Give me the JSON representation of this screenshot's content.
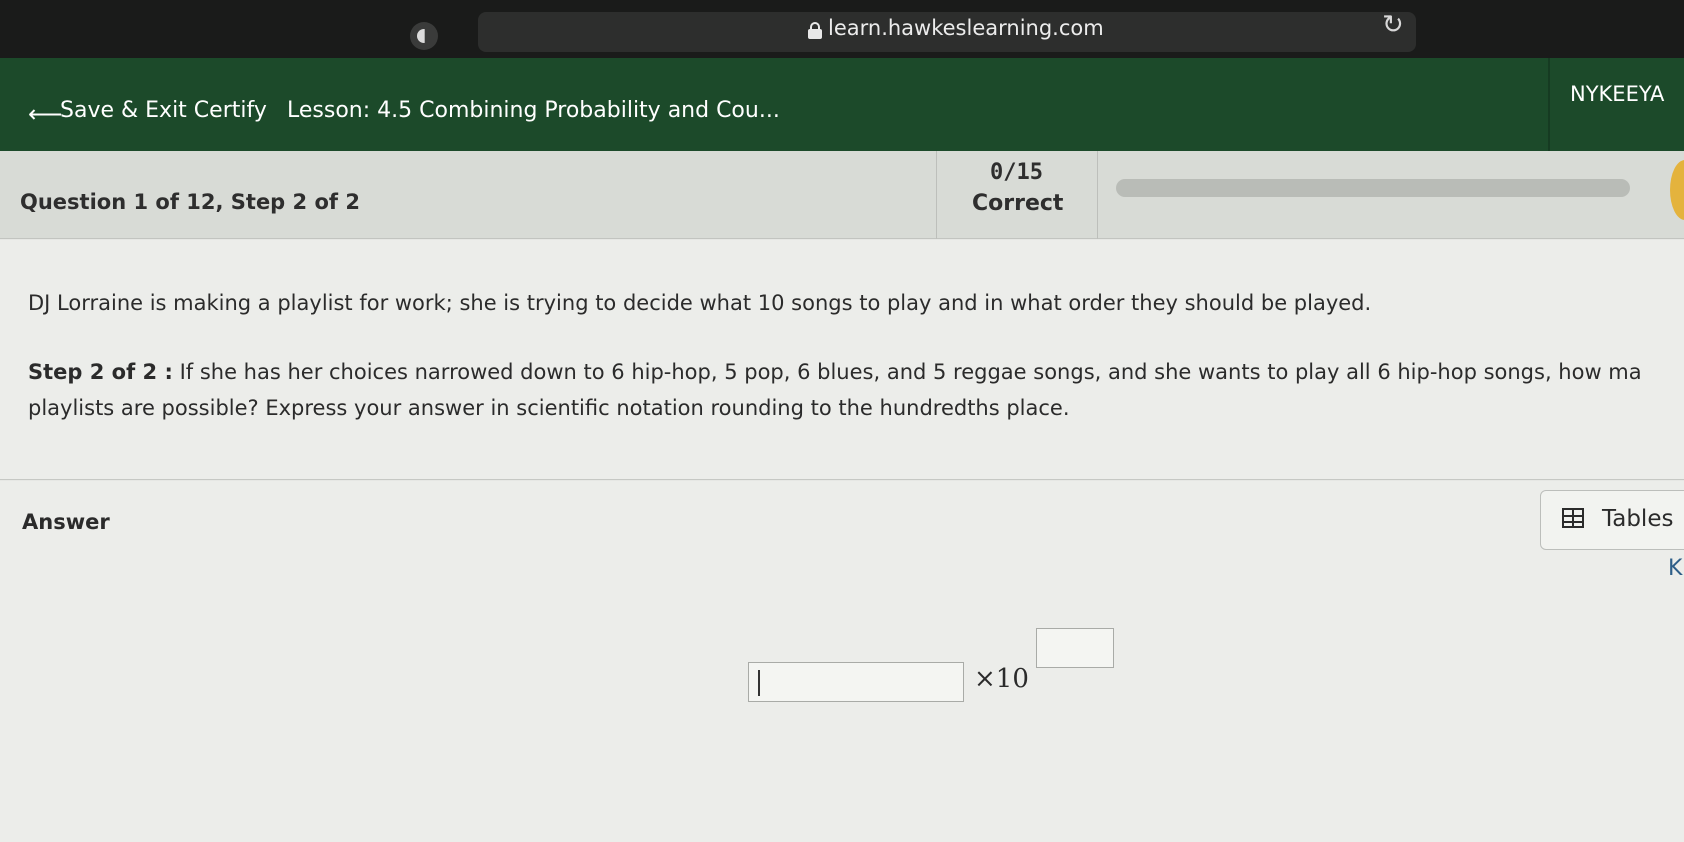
{
  "browser": {
    "url": "learn.hawkeslearning.com"
  },
  "header": {
    "back_label": "Save & Exit Certify",
    "lesson_title": "Lesson: 4.5 Combining Probability and Cou...",
    "user_name": "NYKEEYA"
  },
  "question_bar": {
    "question_label": "Question 1 of 12, Step 2 of 2",
    "score": "0/15",
    "score_label": "Correct",
    "progress_fraction": 0.0
  },
  "question": {
    "prompt": "DJ Lorraine is making a playlist for work; she is trying to decide what 10 songs to play and in what order they should be played.",
    "step_label": "Step 2 of 2 :",
    "step_line1": "If she has her choices narrowed down to 6 hip-hop, 5 pop, 6 blues, and 5 reggae songs, and she wants to play all 6 hip-hop songs, how ma",
    "step_line2": "playlists are possible? Express your answer in scientific notation rounding to the hundredths place."
  },
  "answer": {
    "label": "Answer",
    "tables_label": "Tables",
    "keypad_hint": "K",
    "mantissa_value": "",
    "times_ten": "×10",
    "exponent_value": ""
  },
  "colors": {
    "header_green": "#1c4a2a",
    "progress_fill": "#5b8f3c"
  }
}
